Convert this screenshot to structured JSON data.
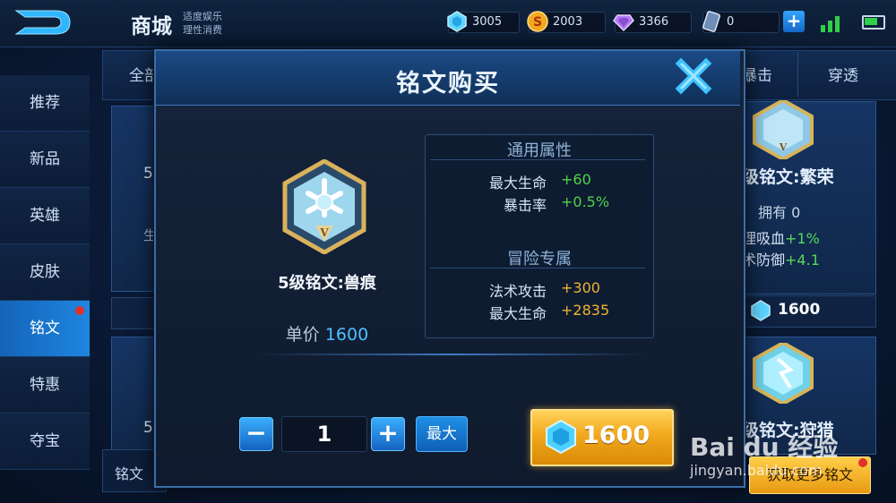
{
  "header": {
    "title": "商城",
    "subtitle_line1": "适度娱乐",
    "subtitle_line2": "理性消费",
    "currencies": [
      {
        "icon": "diamond-gem-icon",
        "value": "3005"
      },
      {
        "icon": "gold-coin-icon",
        "value": "2003"
      },
      {
        "icon": "purple-gem-icon",
        "value": "3366"
      },
      {
        "icon": "coupon-card-icon",
        "value": "0"
      }
    ],
    "plus_label": "+"
  },
  "sidebar": {
    "items": [
      {
        "label": "推荐",
        "active": false
      },
      {
        "label": "新品",
        "active": false
      },
      {
        "label": "英雄",
        "active": false
      },
      {
        "label": "皮肤",
        "active": false
      },
      {
        "label": "铭文",
        "active": true
      },
      {
        "label": "特惠",
        "active": false
      },
      {
        "label": "夺宝",
        "active": false
      }
    ]
  },
  "background": {
    "tab_left": "全部",
    "tab_crit": "暴击",
    "tab_pierce": "穿透",
    "card_left_1": "5",
    "card_left_2": "5",
    "card_left_row": "生",
    "card_right_name": "级铭文:繁荣",
    "card_right_owned": "拥有 0",
    "card_right_attr1_label": "理吸血",
    "card_right_attr1_value": "+1%",
    "card_right_attr2_label": "术防御",
    "card_right_attr2_value": "+4.1",
    "card_right_price": "1600",
    "card_right2_name": "级铭文:狩猎",
    "bottom_left_label": "铭文",
    "more_button": "获取更多铭文"
  },
  "modal": {
    "title": "铭文购买",
    "rune_name": "5级铭文:兽痕",
    "price_label": "单价",
    "price_value": "1600",
    "general_header": "通用属性",
    "general_attrs": [
      {
        "label": "最大生命",
        "value": "+60"
      },
      {
        "label": "暴击率",
        "value": "+0.5%"
      }
    ],
    "adventure_header": "冒险专属",
    "adventure_attrs": [
      {
        "label": "法术攻击",
        "value": "+300"
      },
      {
        "label": "最大生命",
        "value": "+2835"
      }
    ],
    "quantity": "1",
    "minus_label": "−",
    "plus_label": "+",
    "max_label": "最大",
    "buy_amount": "1600"
  },
  "watermark": {
    "logo": "Bai du 经验",
    "url": "jingyan.baidu.com"
  },
  "colors": {
    "accent_blue": "#1e86e0",
    "green_value": "#4fd34a",
    "orange_value": "#f0b232",
    "gold_button": "#f1a81c"
  }
}
